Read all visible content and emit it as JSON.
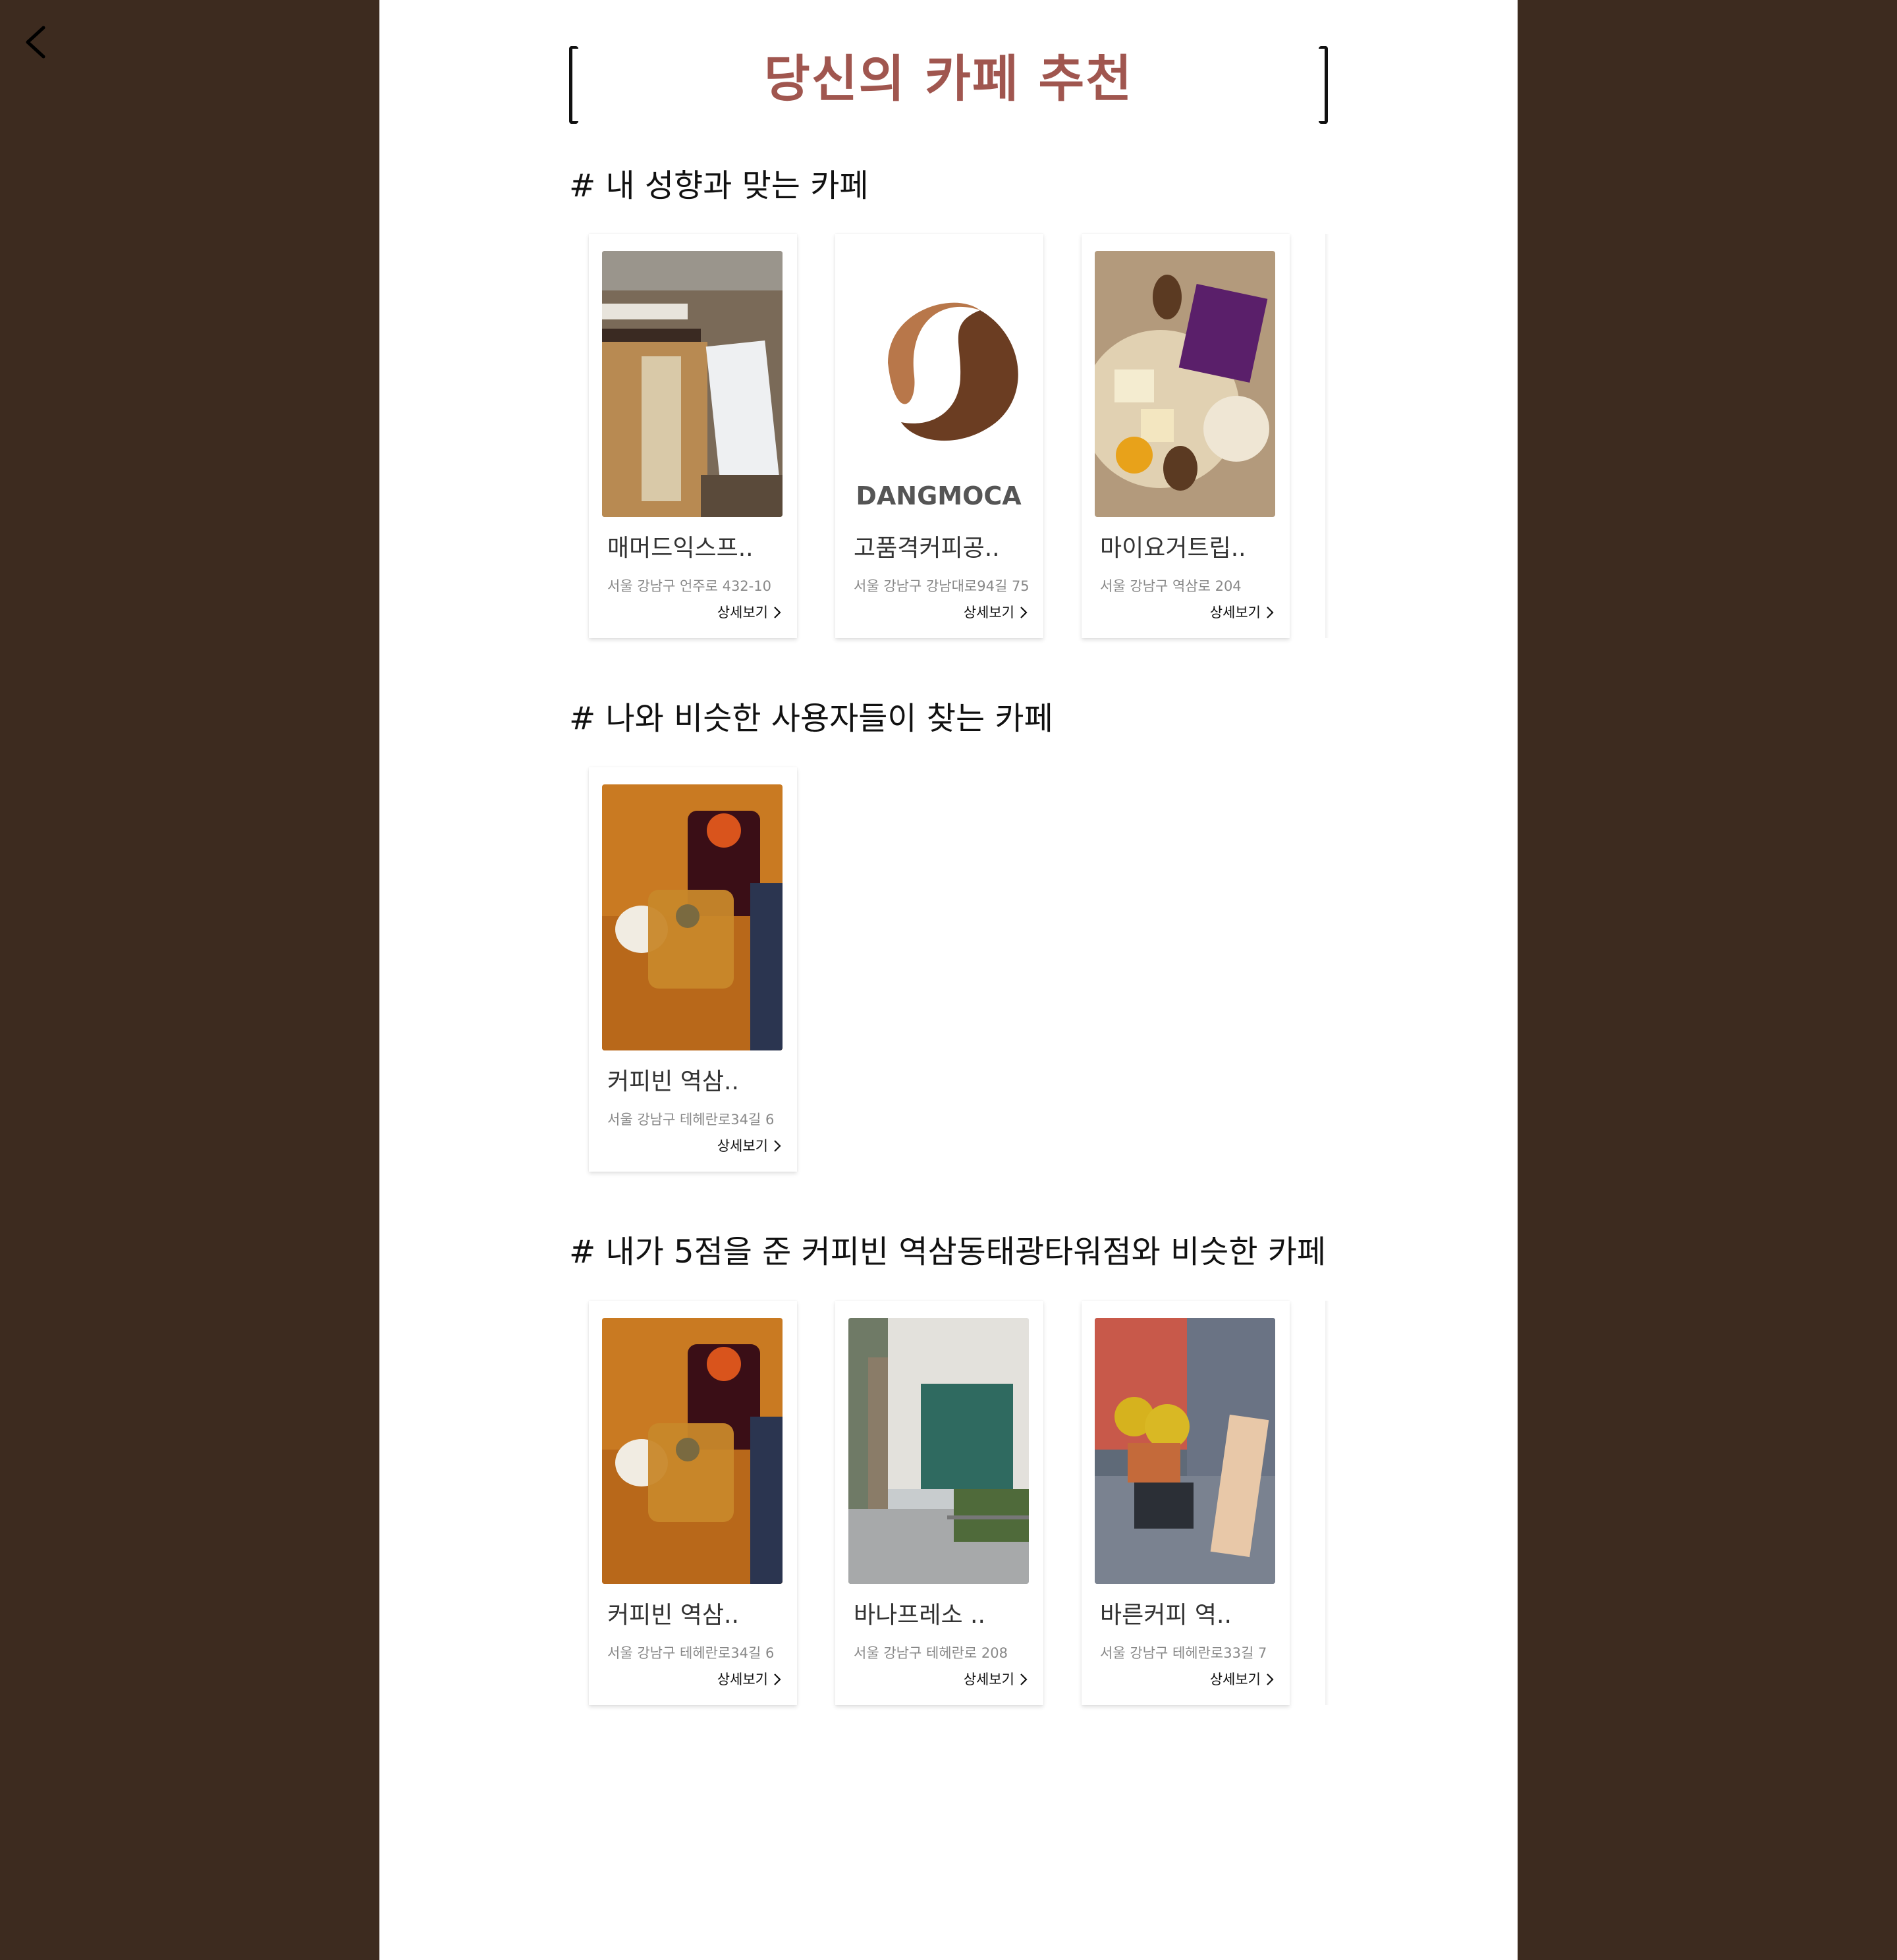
{
  "title": "당신의 카페 추천",
  "detail_label": "상세보기",
  "sections": [
    {
      "title": "# 내 성향과 맞는 카페",
      "cards": [
        {
          "name": "매머드익스프..",
          "address": "서울 강남구 언주로 432-10",
          "photo": "storefront-photo"
        },
        {
          "name": "고품격커피공..",
          "address": "서울 강남구 강남대로94길 75",
          "photo": "coffee-bean-logo",
          "logo_text": "DANGMOCA"
        },
        {
          "name": "마이요거트립..",
          "address": "서울 강남구 역삼로 204",
          "photo": "yogurt-photo"
        }
      ]
    },
    {
      "title": "# 나와 비슷한 사용자들이 찾는 카페",
      "cards": [
        {
          "name": "커피빈 역삼..",
          "address": "서울 강남구 테헤란로34길 6",
          "photo": "tea-photo"
        }
      ]
    },
    {
      "title": "# 내가 5점을 준 커피빈 역삼동태광타워점와 비슷한 카페",
      "cards": [
        {
          "name": "커피빈 역삼..",
          "address": "서울 강남구 테헤란로34길 6",
          "photo": "tea-photo"
        },
        {
          "name": "바나프레소 ..",
          "address": "서울 강남구 테헤란로 208",
          "photo": "building-photo"
        },
        {
          "name": "바른커피 역..",
          "address": "서울 강남구 테헤란로33길 7",
          "photo": "flowers-photo"
        }
      ]
    }
  ],
  "colors": {
    "background": "#3d2b1f",
    "title": "#a0564f",
    "page": "#ffffff"
  }
}
